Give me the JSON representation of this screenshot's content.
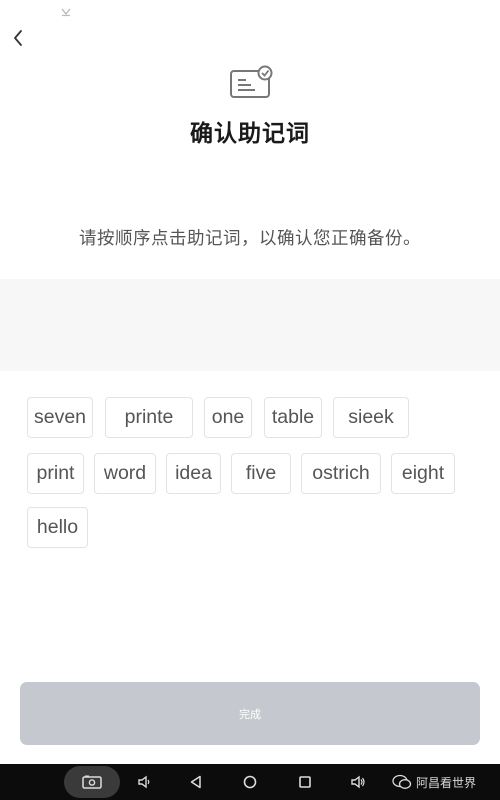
{
  "header": {
    "back_icon": "chevron-left-icon",
    "icon": "card-check-icon",
    "title": "确认助记词"
  },
  "instruction": "请按顺序点击助记词，以确认您正确备份。",
  "selected_words": [],
  "word_options": [
    {
      "label": "seven"
    },
    {
      "label": "printe"
    },
    {
      "label": "one"
    },
    {
      "label": "table"
    },
    {
      "label": "sieek"
    },
    {
      "label": "print"
    },
    {
      "label": "word"
    },
    {
      "label": "idea"
    },
    {
      "label": "five"
    },
    {
      "label": "ostrich"
    },
    {
      "label": "eight"
    },
    {
      "label": "hello"
    }
  ],
  "done_button": {
    "label": "完成",
    "enabled": false,
    "color": "#c5c9cf"
  },
  "navbar": {
    "items": [
      "screenshot-icon",
      "volume-down-icon",
      "back-triangle-icon",
      "home-circle-icon",
      "recent-square-icon",
      "volume-up-icon"
    ]
  },
  "watermark": {
    "text": "阿昌看世界"
  }
}
